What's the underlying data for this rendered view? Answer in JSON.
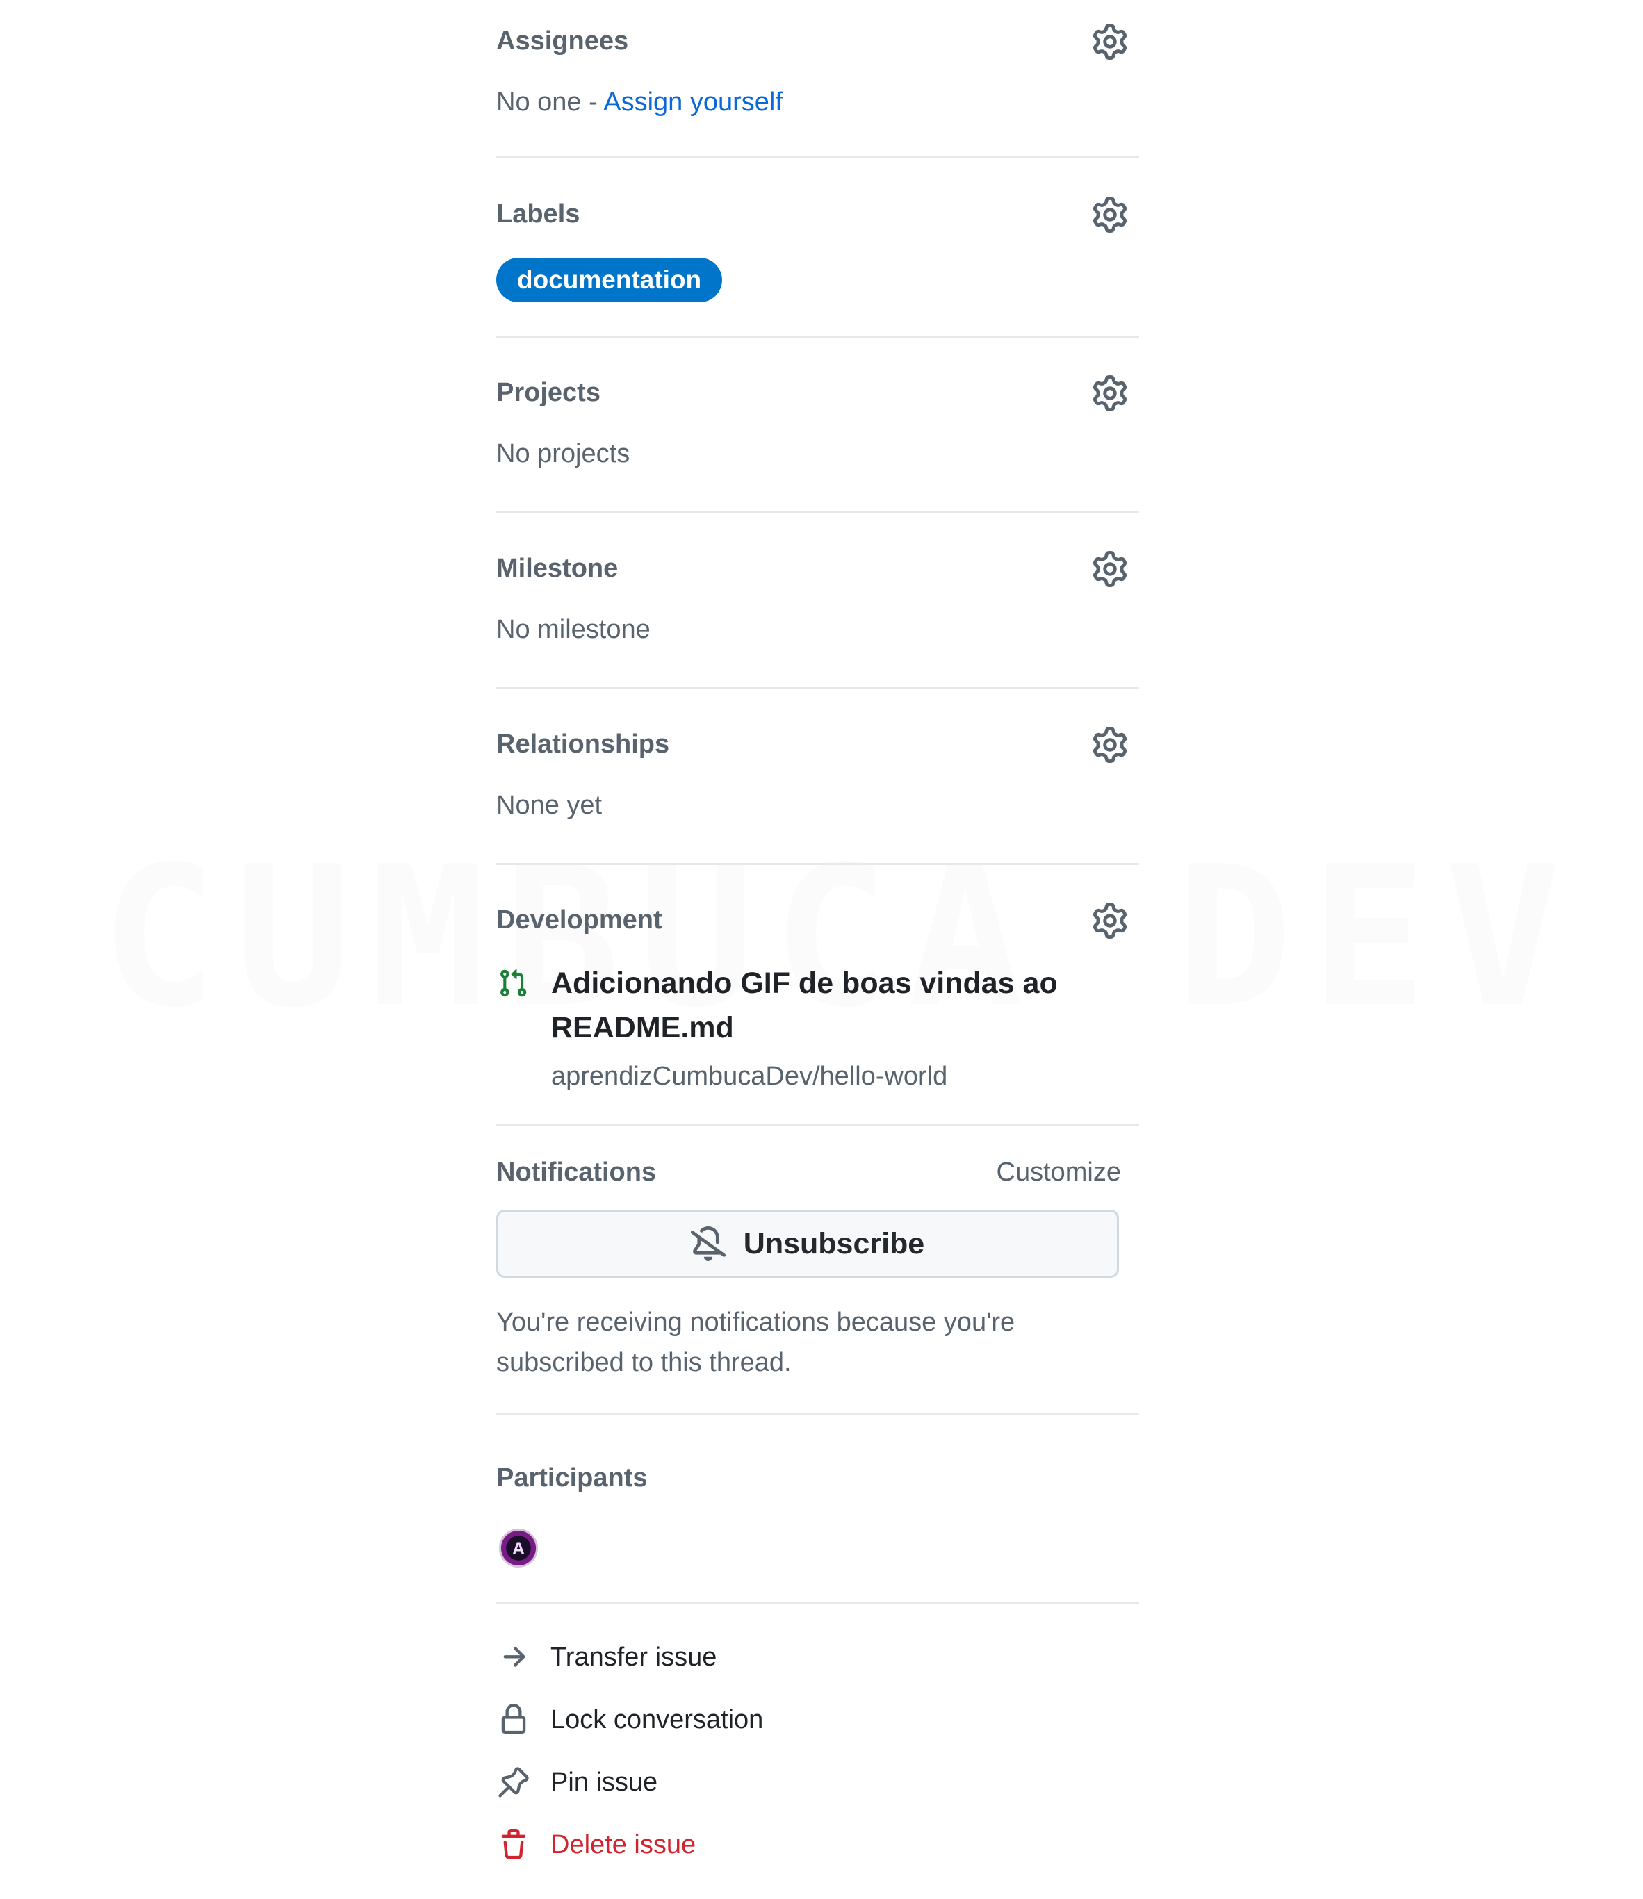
{
  "watermark": "CUMBUCA DEV",
  "assignees": {
    "heading": "Assignees",
    "none_text": "No one - ",
    "assign_link": "Assign yourself"
  },
  "labels": {
    "heading": "Labels",
    "items": [
      {
        "name": "documentation",
        "color": "#0075ca"
      }
    ]
  },
  "projects": {
    "heading": "Projects",
    "empty": "No projects"
  },
  "milestone": {
    "heading": "Milestone",
    "empty": "No milestone"
  },
  "relationships": {
    "heading": "Relationships",
    "empty": "None yet"
  },
  "development": {
    "heading": "Development",
    "pr_title": "Adicionando GIF de boas vindas ao README.md",
    "pr_repo": "aprendizCumbucaDev/hello-world",
    "pr_icon": "git-pull-request-icon",
    "pr_color": "#1a7f37"
  },
  "notifications": {
    "heading": "Notifications",
    "customize": "Customize",
    "button_label": "Unsubscribe",
    "button_icon": "bell-slash-icon",
    "note": "You're receiving notifications because you're subscribed to this thread."
  },
  "participants": {
    "heading": "Participants",
    "avatars": [
      {
        "initial": "A"
      }
    ]
  },
  "actions": [
    {
      "label": "Transfer issue",
      "icon": "arrow-right-icon"
    },
    {
      "label": "Lock conversation",
      "icon": "lock-icon"
    },
    {
      "label": "Pin issue",
      "icon": "pin-icon"
    },
    {
      "label": "Delete issue",
      "icon": "trash-icon",
      "color": "#d1242f"
    }
  ],
  "colors": {
    "link": "#0969da",
    "muted": "#59636e",
    "danger": "#d1242f",
    "border": "#e6e8eb"
  }
}
